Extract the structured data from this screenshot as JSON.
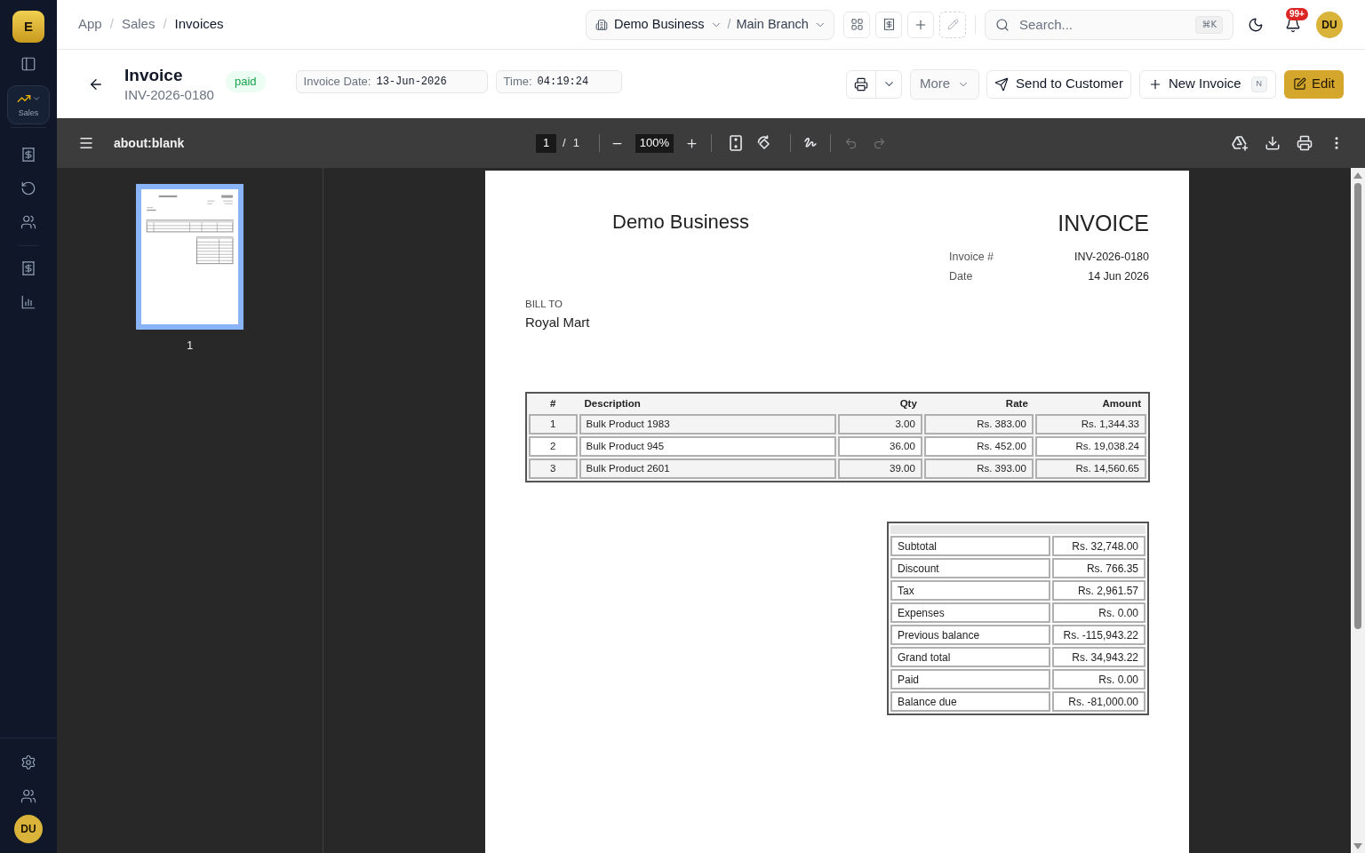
{
  "sidebar": {
    "logo": "E",
    "section": {
      "label": "Sales",
      "selected": true
    },
    "avatar": "DU"
  },
  "topbar": {
    "breadcrumb": [
      {
        "kind": "link",
        "label": "App"
      },
      {
        "kind": "separator",
        "label": "/"
      },
      {
        "kind": "link",
        "label": "Sales"
      },
      {
        "kind": "separator",
        "label": "/"
      },
      {
        "kind": "current",
        "label": "Invoices"
      }
    ],
    "scope": {
      "business": "Demo Business",
      "separator": "/",
      "branch": "Main Branch"
    },
    "search": {
      "placeholder": "Search...",
      "shortcut": "⌘K"
    },
    "notifications": {
      "badge": "99+"
    },
    "avatar": "DU"
  },
  "header": {
    "title": "Invoice",
    "number": "INV-2026-0180",
    "status": "paid",
    "fields": [
      {
        "label": "Invoice Date:",
        "value": "13-Jun-2026"
      },
      {
        "label": "Time:",
        "value": "04:19:24"
      }
    ],
    "more_button": "More",
    "send_button": "Send to Customer",
    "new_button": {
      "label": "New Invoice",
      "shortcut": "N"
    },
    "edit_button": "Edit"
  },
  "pdf_viewer": {
    "title": "about:blank",
    "page": "1",
    "page_separator": "/",
    "page_count": "1",
    "zoom": "100%",
    "undo": {
      "disabled": true
    },
    "redo": {
      "disabled": true
    },
    "thumbnails": [
      {
        "label": "1",
        "selected": true
      }
    ]
  },
  "document": {
    "company": "Demo Business",
    "title": "INVOICE",
    "meta": [
      {
        "label": "Invoice #",
        "value": "INV-2026-0180"
      },
      {
        "label": "Date",
        "value": "14 Jun 2026"
      }
    ],
    "bill_to": {
      "label": "BILL TO",
      "name": "Royal Mart"
    },
    "items_table": {
      "columns": [
        "#",
        "Description",
        "Qty",
        "Rate",
        "Amount"
      ],
      "rows": [
        [
          "1",
          "Bulk Product 1983",
          "3.00",
          "Rs. 383.00",
          "Rs. 1,344.33"
        ],
        [
          "2",
          "Bulk Product 945",
          "36.00",
          "Rs. 452.00",
          "Rs. 19,038.24"
        ],
        [
          "3",
          "Bulk Product 2601",
          "39.00",
          "Rs. 393.00",
          "Rs. 14,560.65"
        ]
      ]
    },
    "totals": [
      {
        "label": "Subtotal",
        "value": "Rs. 32,748.00"
      },
      {
        "label": "Discount",
        "value": "Rs. 766.35"
      },
      {
        "label": "Tax",
        "value": "Rs. 2,961.57"
      },
      {
        "label": "Expenses",
        "value": "Rs. 0.00"
      },
      {
        "label": "Previous balance",
        "value": "Rs. -115,943.22"
      },
      {
        "label": "Grand total",
        "value": "Rs. 34,943.22"
      },
      {
        "label": "Paid",
        "value": "Rs. 0.00"
      },
      {
        "label": "Balance due",
        "value": "Rs. -81,000.00"
      }
    ]
  }
}
